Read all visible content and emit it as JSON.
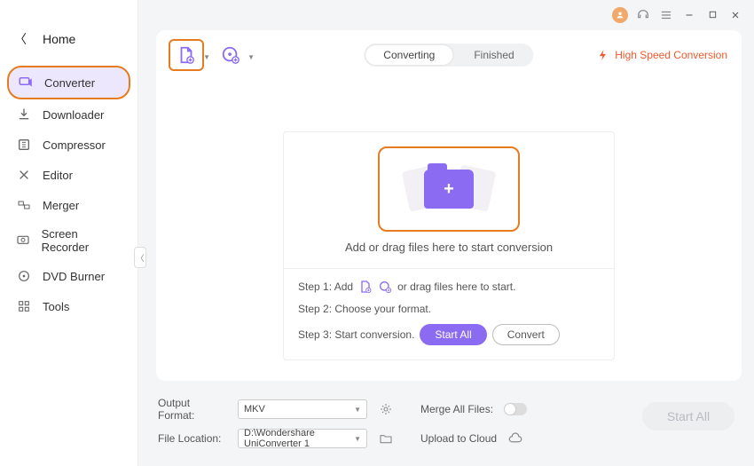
{
  "home": {
    "label": "Home"
  },
  "sidebar": {
    "items": [
      {
        "label": "Converter"
      },
      {
        "label": "Downloader"
      },
      {
        "label": "Compressor"
      },
      {
        "label": "Editor"
      },
      {
        "label": "Merger"
      },
      {
        "label": "Screen Recorder"
      },
      {
        "label": "DVD Burner"
      },
      {
        "label": "Tools"
      }
    ]
  },
  "tabs": {
    "converting": "Converting",
    "finished": "Finished"
  },
  "hsp": {
    "label": "High Speed Conversion"
  },
  "dropzone": {
    "text": "Add or drag files here to start conversion"
  },
  "steps": {
    "s1a": "Step 1: Add",
    "s1b": "or drag files here to start.",
    "s2": "Step 2: Choose your format.",
    "s3": "Step 3: Start conversion.",
    "startAll": "Start All",
    "convert": "Convert"
  },
  "footer": {
    "outputFormatLabel": "Output Format:",
    "outputFormatValue": "MKV",
    "fileLocationLabel": "File Location:",
    "fileLocationValue": "D:\\Wondershare UniConverter 1",
    "mergeLabel": "Merge All Files:",
    "uploadLabel": "Upload to Cloud",
    "startAll": "Start All"
  }
}
